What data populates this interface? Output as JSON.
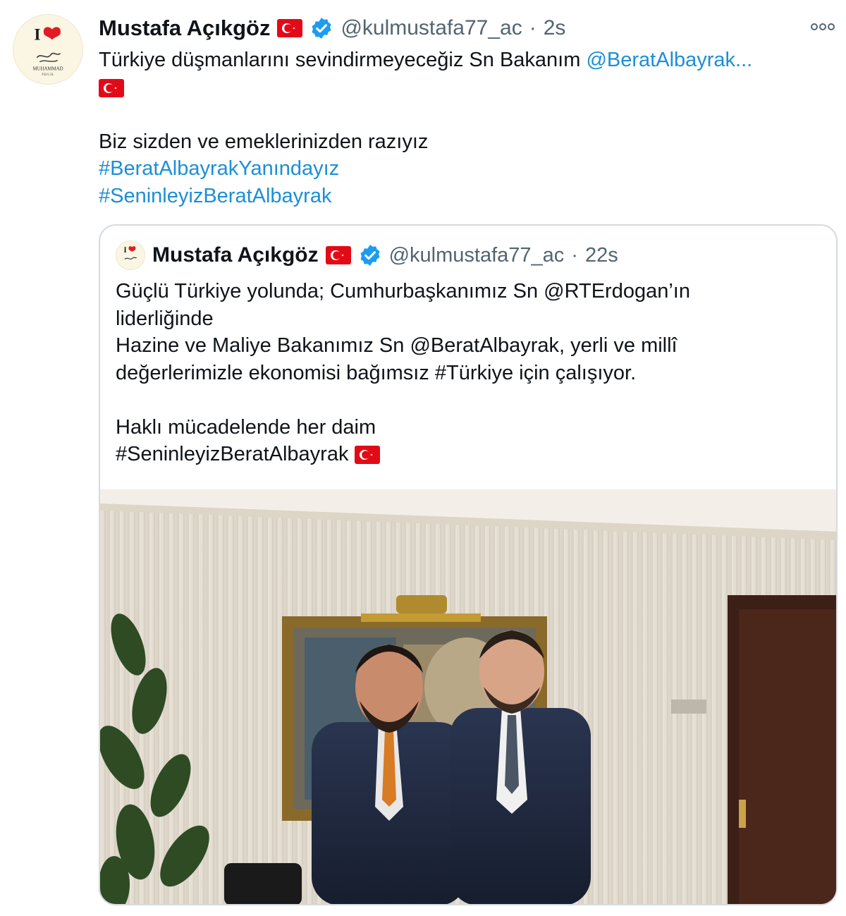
{
  "tweet": {
    "author_name": "Mustafa Açıkgöz",
    "handle": "@kulmustafa77_ac",
    "separator": "·",
    "time": "2s",
    "avatar_label_top": "I",
    "avatar_label_bottom": "MUHAMMAD",
    "avatar_label_sub": "P.B.U.H.",
    "lines": [
      {
        "text": "Türkiye düşmanlarını sevindirmeyeceğiz Sn Bakanım ",
        "link": "@BeratAlbayrak..."
      },
      {
        "text": "",
        "flag": true
      },
      {
        "text": ""
      },
      {
        "text": "Biz sizden ve emeklerinizden razıyız"
      },
      {
        "link": "#BeratAlbayrakYanındayız"
      },
      {
        "link": "#SeninleyizBeratAlbayrak"
      }
    ]
  },
  "quote": {
    "author_name": "Mustafa Açıkgöz",
    "handle": "@kulmustafa77_ac",
    "separator": "·",
    "time": "22s",
    "lines": [
      "Güçlü Türkiye yolunda; Cumhurbaşkanımız Sn @RTErdogan’ın",
      "liderliğinde",
      "Hazine ve Maliye Bakanımız Sn @BeratAlbayrak, yerli ve millî",
      "değerlerimizle ekonomisi bağımsız #Türkiye için çalışıyor.",
      "",
      "Haklı mücadelende her daim",
      "#SeninleyizBeratAlbayrak"
    ]
  },
  "colors": {
    "link": "#1b8fd6",
    "verified": "#1d9bf0",
    "flag_red": "#e30a17",
    "muted": "#536471"
  },
  "icons": [
    "turkish-flag-icon",
    "verified-badge-icon",
    "more-options-icon"
  ]
}
